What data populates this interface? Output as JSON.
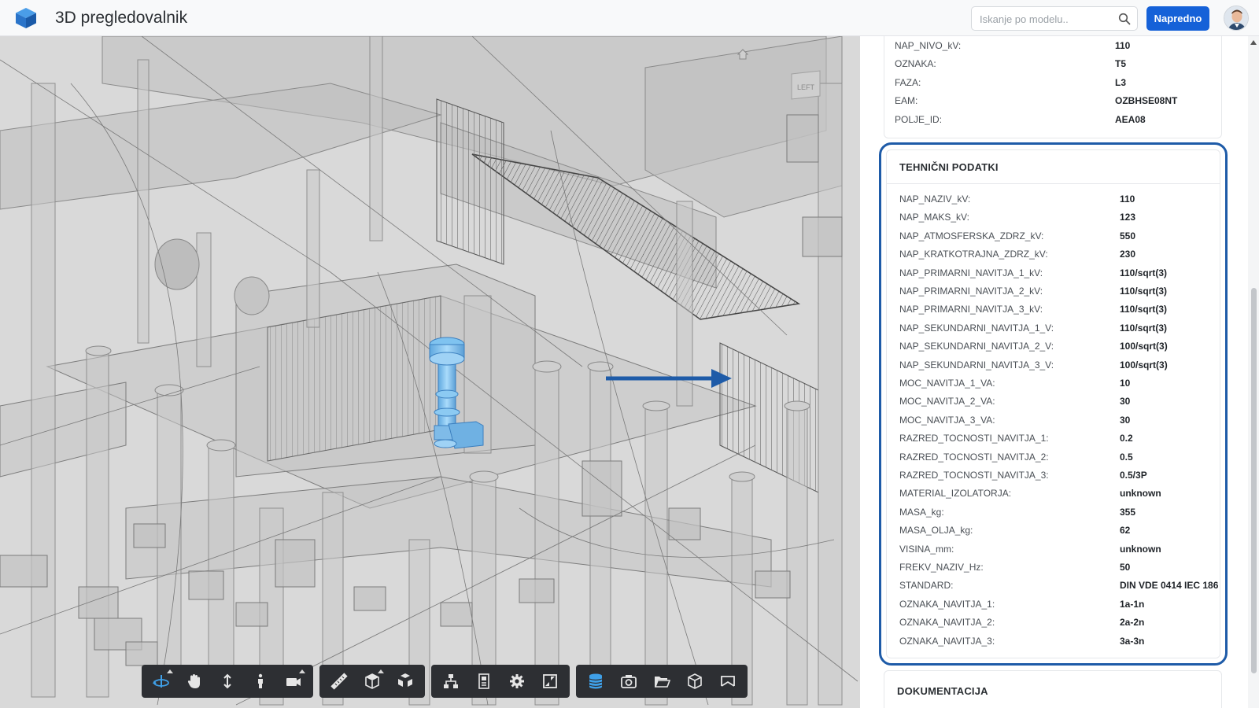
{
  "header": {
    "title": "3D pregledovalnik",
    "search_placeholder": "Iskanje po modelu..",
    "advanced_label": "Napredno"
  },
  "viewport": {
    "navcube_label": "LEFT"
  },
  "properties_top": [
    {
      "key": "NAP_NIVO_kV:",
      "value": "110"
    },
    {
      "key": "OZNAKA:",
      "value": "T5"
    },
    {
      "key": "FAZA:",
      "value": "L3"
    },
    {
      "key": "EAM:",
      "value": "OZBHSE08NT"
    },
    {
      "key": "POLJE_ID:",
      "value": "AEA08"
    }
  ],
  "technical": {
    "title": "TEHNIČNI PODATKI",
    "rows": [
      {
        "key": "NAP_NAZIV_kV:",
        "value": "110"
      },
      {
        "key": "NAP_MAKS_kV:",
        "value": "123"
      },
      {
        "key": "NAP_ATMOSFERSKA_ZDRZ_kV:",
        "value": "550"
      },
      {
        "key": "NAP_KRATKOTRAJNA_ZDRZ_kV:",
        "value": "230"
      },
      {
        "key": "NAP_PRIMARNI_NAVITJA_1_kV:",
        "value": "110/sqrt(3)"
      },
      {
        "key": "NAP_PRIMARNI_NAVITJA_2_kV:",
        "value": "110/sqrt(3)"
      },
      {
        "key": "NAP_PRIMARNI_NAVITJA_3_kV:",
        "value": "110/sqrt(3)"
      },
      {
        "key": "NAP_SEKUNDARNI_NAVITJA_1_V:",
        "value": "110/sqrt(3)"
      },
      {
        "key": "NAP_SEKUNDARNI_NAVITJA_2_V:",
        "value": "100/sqrt(3)"
      },
      {
        "key": "NAP_SEKUNDARNI_NAVITJA_3_V:",
        "value": "100/sqrt(3)"
      },
      {
        "key": "MOC_NAVITJA_1_VA:",
        "value": "10"
      },
      {
        "key": "MOC_NAVITJA_2_VA:",
        "value": "30"
      },
      {
        "key": "MOC_NAVITJA_3_VA:",
        "value": "30"
      },
      {
        "key": "RAZRED_TOCNOSTI_NAVITJA_1:",
        "value": "0.2"
      },
      {
        "key": "RAZRED_TOCNOSTI_NAVITJA_2:",
        "value": "0.5"
      },
      {
        "key": "RAZRED_TOCNOSTI_NAVITJA_3:",
        "value": "0.5/3P"
      },
      {
        "key": "MATERIAL_IZOLATORJA:",
        "value": "unknown"
      },
      {
        "key": "MASA_kg:",
        "value": "355"
      },
      {
        "key": "MASA_OLJA_kg:",
        "value": "62"
      },
      {
        "key": "VISINA_mm:",
        "value": "unknown"
      },
      {
        "key": "FREKV_NAZIV_Hz:",
        "value": "50"
      },
      {
        "key": "STANDARD:",
        "value": "DIN VDE 0414 IEC 186"
      },
      {
        "key": "OZNAKA_NAVITJA_1:",
        "value": "1a-1n"
      },
      {
        "key": "OZNAKA_NAVITJA_2:",
        "value": "2a-2n"
      },
      {
        "key": "OZNAKA_NAVITJA_3:",
        "value": "3a-3n"
      }
    ]
  },
  "documentation": {
    "title": "DOKUMENTACIJA"
  },
  "toolbar": {
    "groups": [
      [
        {
          "icon": "orbit-icon",
          "active": true,
          "submenu": true
        },
        {
          "icon": "pan-hand-icon"
        },
        {
          "icon": "dolly-arrows-icon"
        },
        {
          "icon": "walk-person-icon"
        },
        {
          "icon": "camera-view-icon",
          "submenu": true
        }
      ],
      [
        {
          "icon": "measure-ruler-icon"
        },
        {
          "icon": "section-box-icon",
          "submenu": true
        },
        {
          "icon": "explode-model-icon"
        }
      ],
      [
        {
          "icon": "model-tree-icon"
        },
        {
          "icon": "properties-icon"
        },
        {
          "icon": "settings-gear-icon"
        },
        {
          "icon": "fullscreen-icon"
        }
      ],
      [
        {
          "icon": "layers-stack-icon",
          "active": true
        },
        {
          "icon": "screenshot-camera-icon"
        },
        {
          "icon": "open-folder-icon"
        },
        {
          "icon": "cube-view-icon"
        },
        {
          "icon": "flag-marker-icon"
        }
      ]
    ]
  },
  "colors": {
    "accent": "#1561d8",
    "highlight_border": "#1e5ba8",
    "selected_object": "#7fc3f0",
    "toolbar_bg": "#2d2f33",
    "active_tool": "#3fa0e8"
  }
}
